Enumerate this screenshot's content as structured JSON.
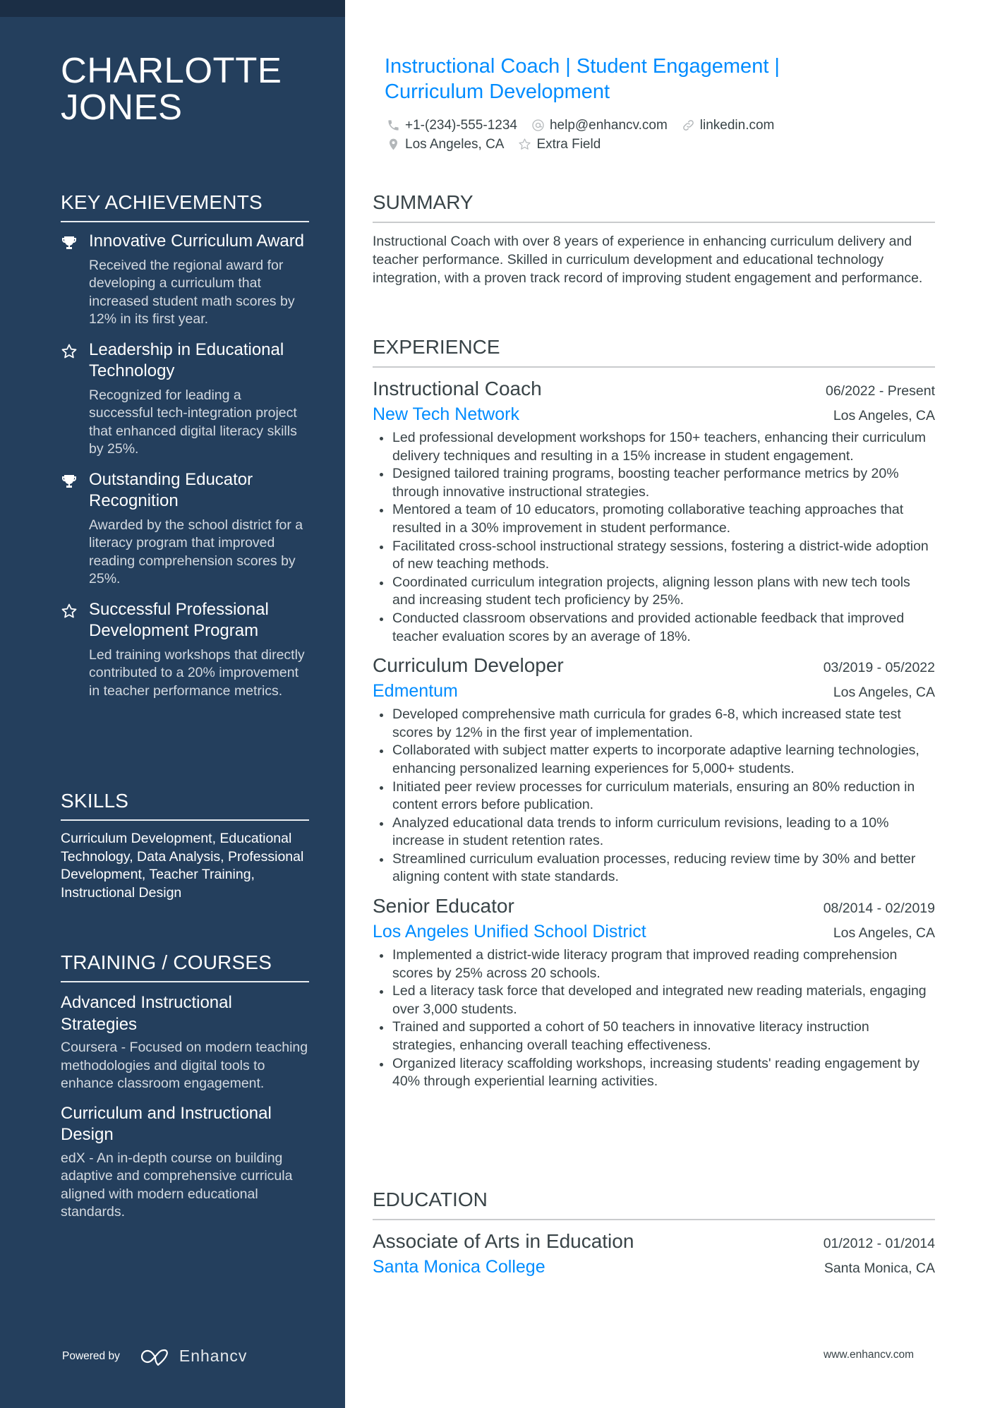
{
  "sidebar": {
    "name": "CHARLOTTE JONES",
    "achievements_title": "KEY ACHIEVEMENTS",
    "achievements": [
      {
        "icon": "trophy-icon",
        "title": "Innovative Curriculum Award",
        "description": "Received the regional award for developing a curriculum that increased student math scores by 12% in its first year."
      },
      {
        "icon": "star-icon",
        "title": "Leadership in Educational Technology",
        "description": "Recognized for leading a successful tech-integration project that enhanced digital literacy skills by 25%."
      },
      {
        "icon": "trophy-icon",
        "title": "Outstanding Educator Recognition",
        "description": "Awarded by the school district for a literacy program that improved reading comprehension scores by 25%."
      },
      {
        "icon": "star-icon",
        "title": "Successful Professional Development Program",
        "description": "Led training workshops that directly contributed to a 20% improvement in teacher performance metrics."
      }
    ],
    "skills_title": "SKILLS",
    "skills_text": "Curriculum Development, Educational Technology, Data Analysis, Professional Development, Teacher Training, Instructional Design",
    "training_title": "TRAINING / COURSES",
    "courses": [
      {
        "title": "Advanced Instructional Strategies",
        "description": "Coursera - Focused on modern teaching methodologies and digital tools to enhance classroom engagement."
      },
      {
        "title": "Curriculum and Instructional Design",
        "description": "edX - An in-depth course on building adaptive and comprehensive curricula aligned with modern educational standards."
      }
    ],
    "powered_by": "Powered by",
    "brand": "Enhancv"
  },
  "header": {
    "headline": "Instructional Coach | Student Engagement | Curriculum Development",
    "contacts": [
      {
        "icon": "phone-icon",
        "text": "+1-(234)-555-1234"
      },
      {
        "icon": "at-icon",
        "text": "help@enhancv.com"
      },
      {
        "icon": "link-icon",
        "text": "linkedin.com"
      },
      {
        "icon": "location-pin-icon",
        "text": "Los Angeles, CA"
      },
      {
        "icon": "star-outline-icon",
        "text": "Extra Field"
      }
    ]
  },
  "summary": {
    "title": "SUMMARY",
    "text": "Instructional Coach with over 8 years of experience in enhancing curriculum delivery and teacher performance. Skilled in curriculum development and educational technology integration, with a proven track record of improving student engagement and performance."
  },
  "experience": {
    "title": "EXPERIENCE",
    "jobs": [
      {
        "title": "Instructional Coach",
        "dates": "06/2022 - Present",
        "company": "New Tech Network",
        "location": "Los Angeles, CA",
        "bullets": [
          "Led professional development workshops for 150+ teachers, enhancing their curriculum delivery techniques and resulting in a 15% increase in student engagement.",
          "Designed tailored training programs, boosting teacher performance metrics by 20% through innovative instructional strategies.",
          "Mentored a team of 10 educators, promoting collaborative teaching approaches that resulted in a 30% improvement in student performance.",
          "Facilitated cross-school instructional strategy sessions, fostering a district-wide adoption of new teaching methods.",
          "Coordinated curriculum integration projects, aligning lesson plans with new tech tools and increasing student tech proficiency by 25%.",
          "Conducted classroom observations and provided actionable feedback that improved teacher evaluation scores by an average of 18%."
        ]
      },
      {
        "title": "Curriculum Developer",
        "dates": "03/2019 - 05/2022",
        "company": "Edmentum",
        "location": "Los Angeles, CA",
        "bullets": [
          "Developed comprehensive math curricula for grades 6-8, which increased state test scores by 12% in the first year of implementation.",
          "Collaborated with subject matter experts to incorporate adaptive learning technologies, enhancing personalized learning experiences for 5,000+ students.",
          "Initiated peer review processes for curriculum materials, ensuring an 80% reduction in content errors before publication.",
          "Analyzed educational data trends to inform curriculum revisions, leading to a 10% increase in student retention rates.",
          "Streamlined curriculum evaluation processes, reducing review time by 30% and better aligning content with state standards."
        ]
      },
      {
        "title": "Senior Educator",
        "dates": "08/2014 - 02/2019",
        "company": "Los Angeles Unified School District",
        "location": "Los Angeles, CA",
        "bullets": [
          "Implemented a district-wide literacy program that improved reading comprehension scores by 25% across 20 schools.",
          "Led a literacy task force that developed and integrated new reading materials, engaging over 3,000 students.",
          "Trained and supported a cohort of 50 teachers in innovative literacy instruction strategies, enhancing overall teaching effectiveness.",
          "Organized literacy scaffolding workshops, increasing students' reading engagement by 40% through experiential learning activities."
        ]
      }
    ]
  },
  "education": {
    "title": "EDUCATION",
    "items": [
      {
        "degree": "Associate of Arts in Education",
        "dates": "01/2012 - 01/2014",
        "school": "Santa Monica College",
        "location": "Santa Monica, CA"
      }
    ]
  },
  "footer": {
    "url": "www.enhancv.com"
  },
  "colors": {
    "sidebar": "#243f5d",
    "topband": "#1b2e45",
    "accent": "#008cff",
    "text": "#384347"
  }
}
